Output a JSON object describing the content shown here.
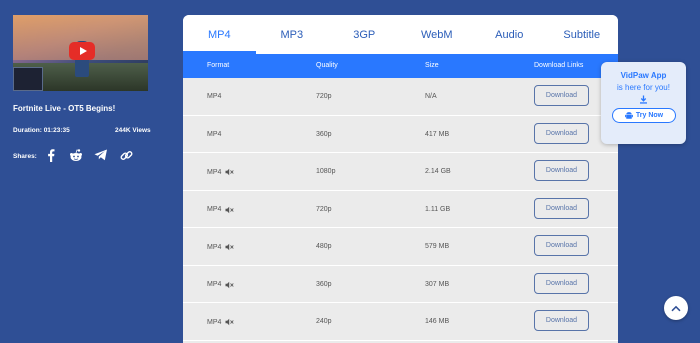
{
  "video": {
    "title": "Fortnite Live - OT5 Begins!",
    "duration": "Duration: 01:23:35",
    "views": "244K Views",
    "shares_label": "Shares:",
    "share_icons": [
      "facebook-icon",
      "reddit-icon",
      "telegram-icon",
      "link-icon"
    ]
  },
  "tabs": [
    "MP4",
    "MP3",
    "3GP",
    "WebM",
    "Audio",
    "Subtitle"
  ],
  "active_tab": "MP4",
  "table": {
    "headers": {
      "format": "Format",
      "quality": "Quality",
      "size": "Size",
      "links": "Download Links"
    },
    "rows": [
      {
        "format": "MP4",
        "muted": false,
        "quality": "720p",
        "size": "N/A",
        "button": "Download"
      },
      {
        "format": "MP4",
        "muted": false,
        "quality": "360p",
        "size": "417 MB",
        "button": "Download"
      },
      {
        "format": "MP4",
        "muted": true,
        "quality": "1080p",
        "size": "2.14 GB",
        "button": "Download"
      },
      {
        "format": "MP4",
        "muted": true,
        "quality": "720p",
        "size": "1.11 GB",
        "button": "Download"
      },
      {
        "format": "MP4",
        "muted": true,
        "quality": "480p",
        "size": "579 MB",
        "button": "Download"
      },
      {
        "format": "MP4",
        "muted": true,
        "quality": "360p",
        "size": "307 MB",
        "button": "Download"
      },
      {
        "format": "MP4",
        "muted": true,
        "quality": "240p",
        "size": "146 MB",
        "button": "Download"
      }
    ]
  },
  "promo": {
    "title": "VidPaw App",
    "subtitle": "is here for you!",
    "button": "Try Now"
  },
  "colors": {
    "background": "#2f4f95",
    "accent": "#2978ff",
    "button_border": "#5874a9"
  }
}
